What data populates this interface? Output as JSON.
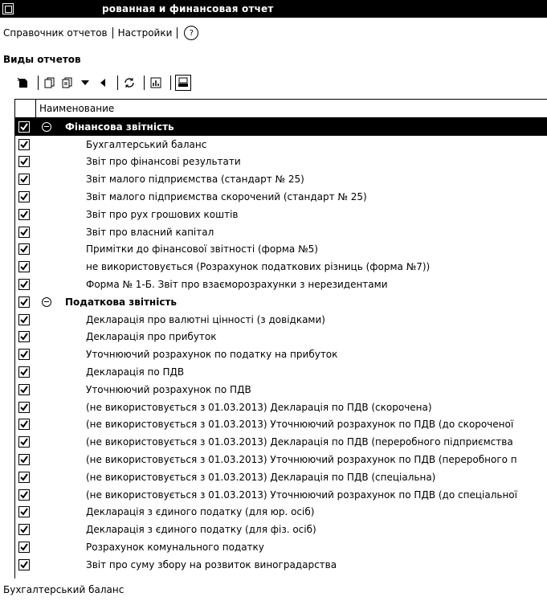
{
  "window": {
    "title": "рованная и финансовая отчет"
  },
  "menu": {
    "items": [
      "Справочник отчетов",
      "Настройки"
    ],
    "help_label": "?"
  },
  "section": {
    "title": "Виды отчетов"
  },
  "toolbar": {
    "icons": [
      "new-report-icon",
      "copy-icon",
      "copy-folder-icon",
      "dropdown-arrow-icon",
      "back-arrow-icon",
      "refresh-icon",
      "chart-icon",
      "print-preview-icon"
    ]
  },
  "grid": {
    "column_header": "Наименование",
    "groups": [
      {
        "label": "Фінансова звітність",
        "items": [
          "Бухгалтерський баланс",
          "Звіт про фінансові результати",
          "Звіт малого підприємства (стандарт № 25)",
          "Звіт малого підприємства скорочений (стандарт № 25)",
          "Звіт про рух грошових коштів",
          "Звіт про власний капітал",
          "Примітки до фінансової звітності (форма №5)",
          "не використовується (Розрахунок податкових різниць (форма №7))",
          "Форма № 1-Б. Звіт про взаєморозрахунки з нерезидентами"
        ]
      },
      {
        "label": "Податкова звітність",
        "items": [
          "Декларація про валютні цінності (з довідками)",
          "Декларація про прибуток",
          "Уточнюючий розрахунок по податку на прибуток",
          "Декларація по ПДВ",
          "Уточнюючий розрахунок по ПДВ",
          "(не використовується з 01.03.2013) Декларація по ПДВ (скорочена)",
          "(не використовується з 01.03.2013) Уточнюючий розрахунок по ПДВ (до скороченої",
          "(не використовується з 01.03.2013) Декларація по ПДВ (переробного підприємства",
          "(не використовується з 01.03.2013) Уточнюючий розрахунок по ПДВ (переробного п",
          "(не використовується з 01.03.2013) Декларація по ПДВ (спеціальна)",
          "(не використовується з 01.03.2013) Уточнюючий розрахунок по ПДВ (до спеціальної",
          "Декларація з єдиного податку (для юр. осіб)",
          "Декларація з єдиного податку (для фіз. осіб)",
          "Розрахунок комунального податку",
          "Звіт про суму збору на розвиток виноградарства"
        ]
      }
    ]
  },
  "status": {
    "text": "Бухгалтерський баланс"
  }
}
